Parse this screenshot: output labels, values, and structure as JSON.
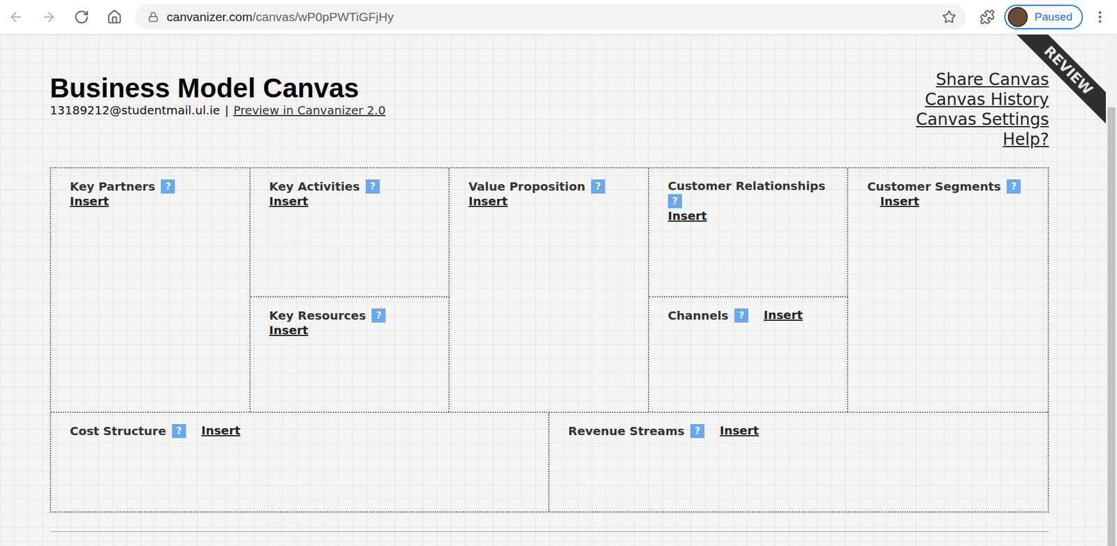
{
  "browser": {
    "url_host": "canvanizer.com",
    "url_path": "/canvas/wP0pPWTiGFjHy",
    "profile_status": "Paused"
  },
  "page": {
    "title": "Business Model Canvas",
    "user": "13189212@studentmail.ul.ie",
    "separator": "|",
    "preview_link": "Preview in Canvanizer 2.0",
    "ribbon": "REVIEW",
    "links": [
      "Share Canvas",
      "Canvas History",
      "Canvas Settings",
      "Help?"
    ]
  },
  "canvas": {
    "blocks": [
      {
        "title": "Key Partners",
        "help": "?",
        "action": "Insert"
      },
      {
        "title": "Key Activities",
        "help": "?",
        "action": "Insert"
      },
      {
        "title": "Key Resources",
        "help": "?",
        "action": "Insert"
      },
      {
        "title": "Value Proposition",
        "help": "?",
        "action": "Insert"
      },
      {
        "title": "Customer Relationships",
        "help": "?",
        "action": "Insert"
      },
      {
        "title": "Channels",
        "help": "?",
        "action": "Insert"
      },
      {
        "title": "Customer Segments",
        "help": "?",
        "action": "Insert"
      },
      {
        "title": "Cost Structure",
        "help": "?",
        "action": "Insert"
      },
      {
        "title": "Revenue Streams",
        "help": "?",
        "action": "Insert"
      }
    ]
  }
}
